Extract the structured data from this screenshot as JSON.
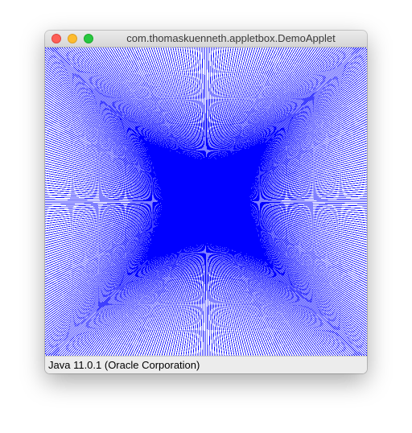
{
  "window": {
    "title": "com.thomaskuenneth.appletbox.DemoApplet",
    "controls": {
      "close_icon": "close-traffic-light",
      "minimize_icon": "minimize-traffic-light",
      "zoom_icon": "zoom-traffic-light"
    },
    "colors": {
      "close": "#fe5f57",
      "minimize": "#febc2e",
      "zoom": "#28c840"
    }
  },
  "applet": {
    "line_color": "#0000ff",
    "background": "#ffffff"
  },
  "status": {
    "text": "Java 11.0.1 (Oracle Corporation)"
  }
}
